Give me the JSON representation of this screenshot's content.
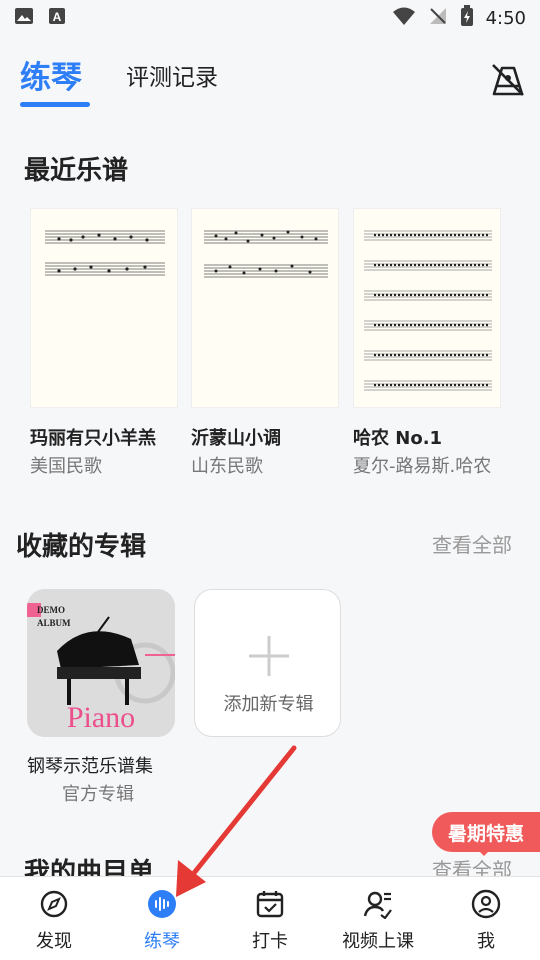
{
  "status": {
    "time": "4:50"
  },
  "header": {
    "tab_active": "练琴",
    "tab_other": "评测记录"
  },
  "recent": {
    "title": "最近乐谱",
    "items": [
      {
        "title": "玛丽有只小羊羔",
        "sub": "美国民歌"
      },
      {
        "title": "沂蒙山小调",
        "sub": "山东民歌"
      },
      {
        "title": "哈农 No.1",
        "sub": "夏尔-路易斯.哈农"
      }
    ]
  },
  "albums": {
    "title": "收藏的专辑",
    "view_all": "查看全部",
    "album": {
      "title": "钢琴示范乐谱集",
      "sub": "官方专辑",
      "cover_demo": "DEMO",
      "cover_album": "ALBUM",
      "cover_piano": "Piano"
    },
    "add_label": "添加新专辑"
  },
  "songlist": {
    "title": "我的曲目单",
    "view_all": "查看全部"
  },
  "promo": {
    "label": "暑期特惠"
  },
  "nav": {
    "items": [
      {
        "label": "发现"
      },
      {
        "label": "练琴"
      },
      {
        "label": "打卡"
      },
      {
        "label": "视频上课"
      },
      {
        "label": "我"
      }
    ]
  },
  "colors": {
    "accent": "#2d7ef7",
    "promo": "#f05a5a",
    "arrow": "#e53935"
  }
}
